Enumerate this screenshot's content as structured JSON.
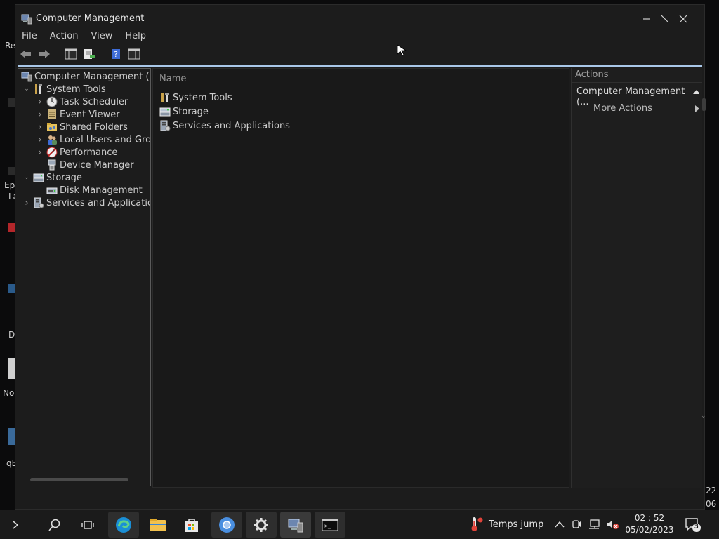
{
  "desktop": {
    "fragments": [
      "Re",
      "Ep",
      "La",
      "D",
      "No",
      "qE"
    ],
    "right_edge": [
      "22",
      "06"
    ]
  },
  "window": {
    "title": "Computer Management",
    "controls": {
      "minimize": "minimize",
      "maximize": "maximize",
      "close": "close"
    },
    "menu": [
      "File",
      "Action",
      "View",
      "Help"
    ]
  },
  "tree": {
    "root": "Computer Management (Local)",
    "items": [
      {
        "label": "System Tools",
        "level": 1,
        "expander": "expanded",
        "icon": "tools-icon"
      },
      {
        "label": "Task Scheduler",
        "level": 2,
        "expander": "collapsed",
        "icon": "clock-icon"
      },
      {
        "label": "Event Viewer",
        "level": 2,
        "expander": "collapsed",
        "icon": "event-viewer-icon"
      },
      {
        "label": "Shared Folders",
        "level": 2,
        "expander": "collapsed",
        "icon": "shared-folder-icon"
      },
      {
        "label": "Local Users and Groups",
        "level": 2,
        "expander": "collapsed",
        "icon": "users-icon"
      },
      {
        "label": "Performance",
        "level": 2,
        "expander": "collapsed",
        "icon": "performance-icon"
      },
      {
        "label": "Device Manager",
        "level": 2,
        "expander": "none",
        "icon": "device-manager-icon"
      },
      {
        "label": "Storage",
        "level": 1,
        "expander": "expanded",
        "icon": "storage-icon"
      },
      {
        "label": "Disk Management",
        "level": 2,
        "expander": "none",
        "icon": "disk-icon"
      },
      {
        "label": "Services and Applications",
        "level": 1,
        "expander": "collapsed",
        "icon": "services-icon"
      }
    ]
  },
  "list": {
    "column_name": "Name",
    "rows": [
      {
        "label": "System Tools",
        "icon": "tools-icon"
      },
      {
        "label": "Storage",
        "icon": "storage-icon"
      },
      {
        "label": "Services and Applications",
        "icon": "services-icon"
      }
    ]
  },
  "actions": {
    "header": "Actions",
    "group_title": "Computer Management (...",
    "more_actions": "More Actions"
  },
  "taskbar": {
    "weather_text": "Temps jump",
    "time": "02 : 52",
    "date": "05/02/2023",
    "notification_count": "3"
  },
  "colors": {
    "accent_line": "#a9c7e8",
    "window_bg": "#1c1c1c",
    "taskbar_bg": "#1b1b1b"
  }
}
